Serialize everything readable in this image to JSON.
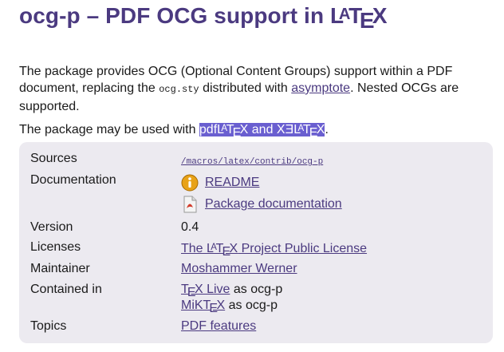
{
  "page": {
    "title_prefix": "ocg-p – PDF OCG support in ",
    "latex": {
      "l": "L",
      "a": "A",
      "t": "T",
      "e": "E",
      "x": "X"
    }
  },
  "intro": {
    "p1_a": "The package provides OCG (Optional Content Groups) support within a PDF document, replacing the ",
    "p1_code": "ocg.sty",
    "p1_b": " distributed with ",
    "p1_link": "asymptote",
    "p1_c": ". Nested OCGs are supported.",
    "p2_a": "The package may be used with ",
    "p2_pdf": "pdf",
    "p2_and": " and ",
    "p2_xe": "XƎ",
    "p2_end": "."
  },
  "details": {
    "sources_label": "Sources",
    "sources_value": "/macros/latex/contrib/ocg-p",
    "documentation_label": "Documentation",
    "docs": [
      {
        "label": "README",
        "icon": "readme-info-icon"
      },
      {
        "label": "Package documentation",
        "icon": "pdf-file-icon"
      }
    ],
    "version_label": "Version",
    "version_value": "0.4",
    "licenses_label": "Licenses",
    "license_prefix": "The ",
    "license_suffix": " Project Public License",
    "maintainer_label": "Maintainer",
    "maintainer_value": "Moshammer Werner",
    "contained_label": "Contained in",
    "texlive_link_t": "T",
    "texlive_link_e": "E",
    "texlive_link_x": "X Live",
    "texlive_suffix": " as ocg-p",
    "miktex_link_a": "MiKT",
    "miktex_link_e": "E",
    "miktex_link_x": "X",
    "miktex_suffix": " as ocg-p",
    "topics_label": "Topics",
    "topics_value": "PDF features"
  },
  "colors": {
    "title": "#4b3a80",
    "link": "#4b3a80",
    "selection": "#6a5fd0",
    "box_bg": "#eceaf0"
  }
}
